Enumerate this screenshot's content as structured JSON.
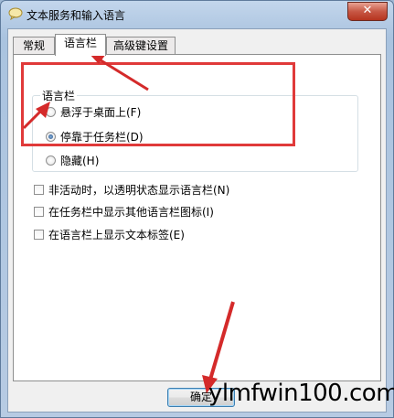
{
  "window": {
    "title": "文本服务和输入语言",
    "close_glyph": "✕"
  },
  "tabs": [
    {
      "label": "常规"
    },
    {
      "label": "语言栏"
    },
    {
      "label": "高级键设置"
    }
  ],
  "language_bar_group": {
    "label": "语言栏",
    "options": [
      {
        "label": "悬浮于桌面上(F)",
        "selected": false
      },
      {
        "label": "停靠于任务栏(D)",
        "selected": true
      },
      {
        "label": "隐藏(H)",
        "selected": false
      }
    ]
  },
  "checkboxes": [
    {
      "label": "非活动时，以透明状态显示语言栏(N)",
      "checked": false
    },
    {
      "label": "在任务栏中显示其他语言栏图标(I)",
      "checked": false
    },
    {
      "label": "在语言栏上显示文本标签(E)",
      "checked": false
    }
  ],
  "buttons": {
    "ok": "确定"
  },
  "watermark": "ylmfwin100.com",
  "colors": {
    "annotation_red": "#e03a3a",
    "arrow_red": "#d42a2a"
  }
}
